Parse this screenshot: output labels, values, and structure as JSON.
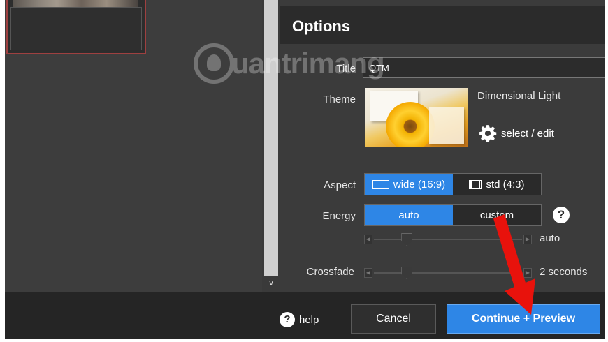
{
  "options": {
    "title": "Options",
    "title_label": "Title",
    "title_value": "QTM",
    "theme_label": "Theme",
    "theme_name": "Dimensional Light",
    "select_edit": "select / edit",
    "aspect_label": "Aspect",
    "aspect_options": [
      "wide (16:9)",
      "std (4:3)"
    ],
    "aspect_selected": "wide (16:9)",
    "energy_label": "Energy",
    "energy_options": [
      "auto",
      "custom"
    ],
    "energy_selected": "auto",
    "energy_value": "auto",
    "energy_level": 0.2,
    "crossfade_label": "Crossfade",
    "crossfade_value": "2 seconds",
    "crossfade_level": 0.2,
    "help_glyph": "?"
  },
  "bottom": {
    "help_label": "help",
    "cancel_label": "Cancel",
    "continue_label": "Continue + Preview"
  },
  "watermark": {
    "text": "uantrimang"
  },
  "colors": {
    "accent": "#2e86e6",
    "arrow": "#e8120c",
    "background": "#3b3b3b"
  },
  "icons": [
    "gear-icon",
    "help-icon",
    "wide-aspect-icon",
    "std-aspect-icon",
    "chevron-down-icon",
    "red-arrow-annotation"
  ]
}
